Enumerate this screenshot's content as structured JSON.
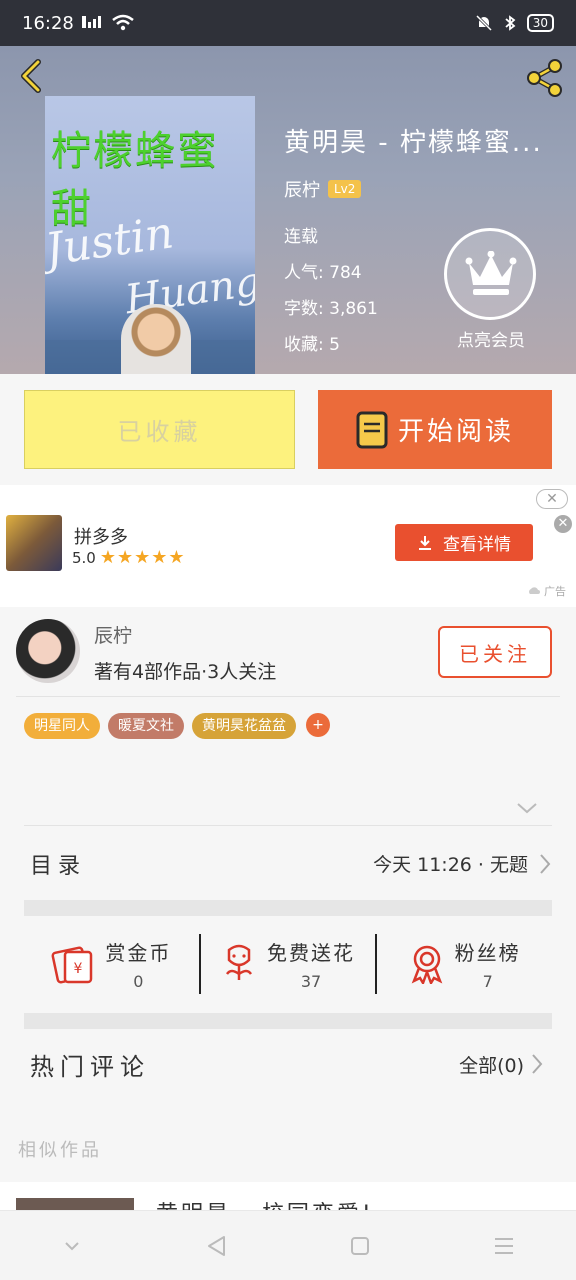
{
  "status_bar": {
    "time": "16:28",
    "battery": "30"
  },
  "book": {
    "title": "黄明昊 - 柠檬蜂蜜...",
    "author": "辰柠",
    "level": "Lv2",
    "status": "连载",
    "popularity": "人气: 784",
    "word_count": "字数: 3,861",
    "favorites": "收藏: 5",
    "vip_label": "点亮会员",
    "cover": {
      "title": "柠檬蜂蜜甜",
      "script_line1": "Justin",
      "script_line2": "Huang"
    }
  },
  "actions": {
    "collected_label": "已收藏",
    "read_label": "开始阅读"
  },
  "ad": {
    "app_name": "拼多多",
    "rating": "5.0",
    "stars": "★★★★★",
    "button_label": "查看详情",
    "close_label": "✕",
    "close_label_2": "✕",
    "tag": "广告"
  },
  "author_section": {
    "name": "辰柠",
    "description": "著有4部作品·3人关注",
    "follow_label": "已关注",
    "tags": [
      {
        "label": "明星同人",
        "color": "#f2ae3a"
      },
      {
        "label": "暖夏文社",
        "color": "#c27b68"
      },
      {
        "label": "黄明昊花盆盆",
        "color": "#d6a338"
      }
    ],
    "add_tag_label": "+"
  },
  "catalog": {
    "label": "目录",
    "latest": "今天 11:26 · 无题"
  },
  "stats": [
    {
      "label": "赏金币",
      "value": "0",
      "icon": "red-envelope-icon"
    },
    {
      "label": "免费送花",
      "value": "37",
      "icon": "flower-icon"
    },
    {
      "label": "粉丝榜",
      "value": "7",
      "icon": "medal-icon"
    }
  ],
  "comments": {
    "label": "热门评论",
    "all_label": "全部(0)"
  },
  "similar": {
    "label": "相似作品",
    "first_title": "黄明昊 - 校园恋爱!"
  },
  "colors": {
    "accent": "#eb6b3a",
    "collected_bg": "#fdf27e",
    "ad_button": "#e9502f"
  }
}
